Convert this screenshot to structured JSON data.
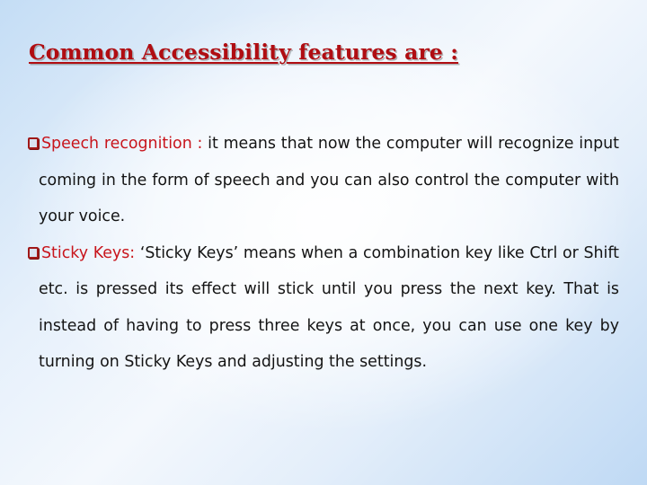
{
  "title": "Common Accessibility features are :",
  "colors": {
    "title": "#b00d12",
    "term": "#c8151c",
    "body_text": "#141414",
    "bullet_box": "#a01818",
    "background_edge": "#c4ddf5",
    "background_center": "#f4f8fd"
  },
  "bullets": [
    {
      "icon": "checkbox-square-icon",
      "term": "Speech recognition : ",
      "text": "it means that now the computer will recognize input coming in the form of speech and you can also control the computer with your voice."
    },
    {
      "icon": "checkbox-square-icon",
      "term": "Sticky Keys: ",
      "text": "‘Sticky Keys’ means when a combination key like Ctrl or Shift etc. is pressed its effect will stick until you press the next key. That is instead of having to press three keys at once, you can use one key by turning on Sticky Keys and adjusting the settings."
    }
  ]
}
